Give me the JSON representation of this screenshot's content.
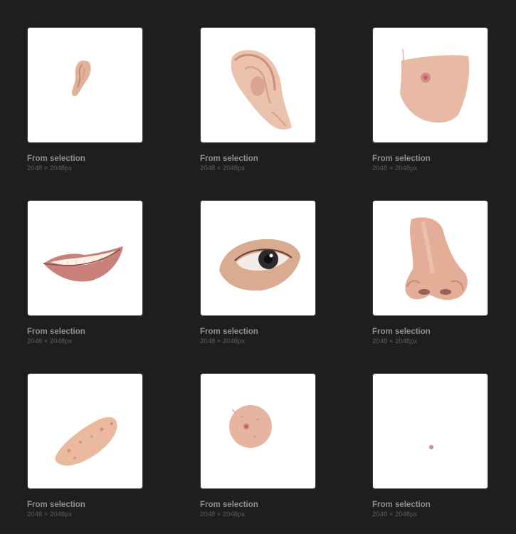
{
  "gallery": {
    "items": [
      {
        "title": "From selection",
        "dimensions": "2048 × 2048px",
        "content_icon": "small-ear-image"
      },
      {
        "title": "From selection",
        "dimensions": "2048 × 2048px",
        "content_icon": "large-ear-image"
      },
      {
        "title": "From selection",
        "dimensions": "2048 × 2048px",
        "content_icon": "skin-patch-image"
      },
      {
        "title": "From selection",
        "dimensions": "2048 × 2048px",
        "content_icon": "lips-image"
      },
      {
        "title": "From selection",
        "dimensions": "2048 × 2048px",
        "content_icon": "eye-image"
      },
      {
        "title": "From selection",
        "dimensions": "2048 × 2048px",
        "content_icon": "nose-image"
      },
      {
        "title": "From selection",
        "dimensions": "2048 × 2048px",
        "content_icon": "cheek-patch-image"
      },
      {
        "title": "From selection",
        "dimensions": "2048 × 2048px",
        "content_icon": "round-skin-image"
      },
      {
        "title": "From selection",
        "dimensions": "2048 × 2048px",
        "content_icon": "tiny-dot-image"
      }
    ]
  },
  "colors": {
    "background": "#1e1e1e",
    "card_bg": "#ffffff",
    "title_text": "#8e8e8e",
    "dims_text": "#5e5e5e",
    "skin": "#e8b8a4"
  }
}
